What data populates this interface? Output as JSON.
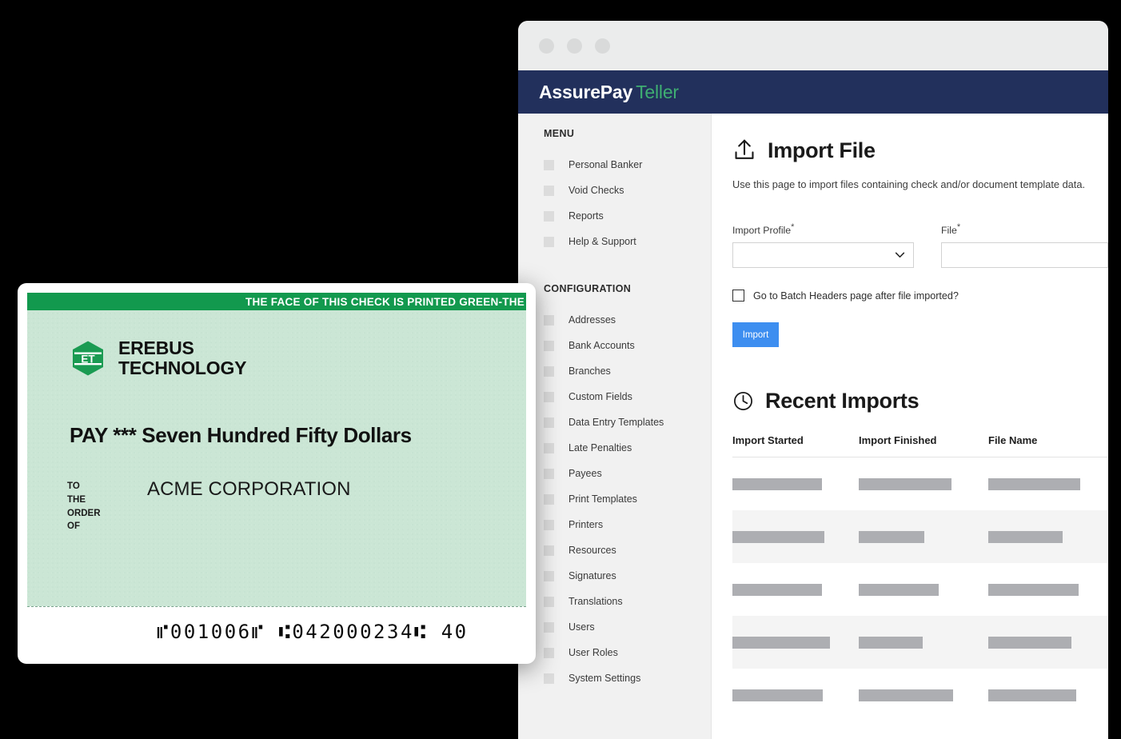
{
  "browser": {
    "traffic_lights": [
      "close-dot",
      "minimize-dot",
      "maximize-dot"
    ]
  },
  "app": {
    "brand_primary": "AssurePay",
    "brand_secondary": "Teller",
    "header_color": "#22305c",
    "accent_green": "#3fae72",
    "accent_blue": "#3d8ef0"
  },
  "sidebar": {
    "menu_title": "MENU",
    "menu_items": [
      {
        "label": "Personal Banker"
      },
      {
        "label": "Void Checks"
      },
      {
        "label": "Reports"
      },
      {
        "label": "Help & Support"
      }
    ],
    "config_title": "CONFIGURATION",
    "config_items": [
      {
        "label": "Addresses"
      },
      {
        "label": "Bank Accounts"
      },
      {
        "label": "Branches"
      },
      {
        "label": "Custom Fields"
      },
      {
        "label": "Data Entry Templates"
      },
      {
        "label": "Late Penalties"
      },
      {
        "label": "Payees"
      },
      {
        "label": "Print Templates"
      },
      {
        "label": "Printers"
      },
      {
        "label": "Resources"
      },
      {
        "label": "Signatures"
      },
      {
        "label": "Translations"
      },
      {
        "label": "Users"
      },
      {
        "label": "User Roles"
      },
      {
        "label": "System Settings"
      }
    ]
  },
  "main": {
    "page_title": "Import File",
    "page_icon": "upload-icon",
    "page_description": "Use this page to import files containing check and/or document template data.",
    "form": {
      "import_profile_label": "Import Profile",
      "import_profile_required": "*",
      "import_profile_value": "",
      "file_label": "File",
      "file_required": "*",
      "file_value": "",
      "checkbox_label": "Go to Batch Headers page after file imported?",
      "checkbox_checked": false,
      "import_button_label": "Import"
    },
    "recent": {
      "section_title": "Recent Imports",
      "section_icon": "clock-icon",
      "columns": [
        "Import Started",
        "Import Finished",
        "File Name"
      ],
      "rows": [
        {
          "started_w": 112,
          "finished_w": 116,
          "file_w": 115
        },
        {
          "started_w": 115,
          "finished_w": 82,
          "file_w": 93
        },
        {
          "started_w": 112,
          "finished_w": 100,
          "file_w": 113
        },
        {
          "started_w": 122,
          "finished_w": 80,
          "file_w": 104
        },
        {
          "started_w": 113,
          "finished_w": 118,
          "file_w": 110
        }
      ]
    }
  },
  "check": {
    "security_band_text": "THE FACE OF THIS CHECK IS PRINTED GREEN-THE",
    "logo_mark": "ET",
    "company_line1": "EREBUS",
    "company_line2": "TECHNOLOGY",
    "pay_prefix": "PAY ***",
    "amount_words": "Seven Hundred Fifty Dollars",
    "order_label_line1": "TO",
    "order_label_line2": "THE",
    "order_label_line3": "ORDER",
    "order_label_line4": "OF",
    "payee": "ACME CORPORATION",
    "micr_line": "⑈001006⑈  ⑆042000234⑆  40",
    "green_band_color": "#12994e",
    "check_face_color": "#cbe6d5"
  }
}
